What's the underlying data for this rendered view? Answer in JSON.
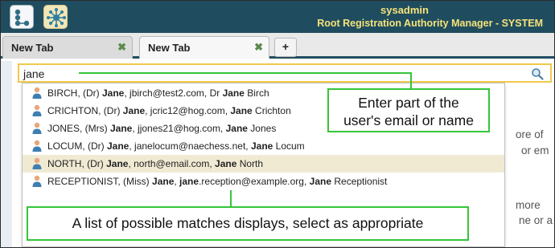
{
  "header": {
    "user": "sysadmin",
    "role": "Root Registration Authority Manager - SYSTEM"
  },
  "tabs": [
    {
      "label": "New Tab",
      "close": "✖"
    },
    {
      "label": "New Tab",
      "close": "✖"
    }
  ],
  "add_tab_label": "+",
  "search": {
    "value": "jane"
  },
  "background_text": {
    "line1": "ore  of",
    "line2": "or em",
    "line3": "more",
    "line4": "ne or a"
  },
  "matches": [
    {
      "p1": "BIRCH, (Dr) ",
      "b1": "Jane",
      "p2": ", jbirch@test2.com, Dr ",
      "b2": "Jane",
      "p3": " Birch",
      "selected": false
    },
    {
      "p1": "CRICHTON, (Dr) ",
      "b1": "Jane",
      "p2": ", jcric12@hog.com, ",
      "b2": "Jane",
      "p3": " Crichton",
      "selected": false
    },
    {
      "p1": "JONES, (Mrs) ",
      "b1": "Jane",
      "p2": ", jjones21@hog.com, ",
      "b2": "Jane",
      "p3": " Jones",
      "selected": false
    },
    {
      "p1": "LOCUM, (Dr) ",
      "b1": "Jane",
      "p2": ", janelocum@naechess.net, ",
      "b2": "Jane",
      "p3": " Locum",
      "selected": false
    },
    {
      "p1": "NORTH, (Dr) ",
      "b1": "Jane",
      "p2": ", north@email.com, ",
      "b2": "Jane",
      "p3": " North",
      "selected": true
    },
    {
      "p1": "RECEPTIONIST, (Miss) ",
      "b1": "Jane",
      "p2": ", ",
      "b2": "jane",
      "p3": ".reception@example.org, ",
      "b3": "Jane",
      "p4": " Receptionist",
      "selected": false
    }
  ],
  "callouts": {
    "search_hint_line1": "Enter part of the",
    "search_hint_line2": "user's email or name",
    "matches_hint": "A list of possible matches displays, select as appropriate"
  },
  "colors": {
    "header_bg": "#1f4d5f",
    "header_text": "#f6e27a",
    "search_border": "#f1c94a",
    "selected_row": "#f0ead3",
    "callout_border": "#35c53a"
  }
}
